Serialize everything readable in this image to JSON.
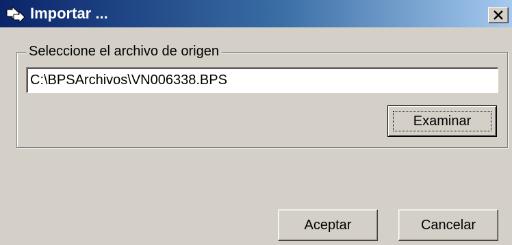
{
  "window": {
    "title": "Importar ...",
    "close_glyph": "X"
  },
  "source_group": {
    "legend": "Seleccione el archivo de origen",
    "path_value": "C:\\BPSArchivos\\VN006338.BPS",
    "browse_label": "Examinar"
  },
  "actions": {
    "accept_label": "Aceptar",
    "cancel_label": "Cancelar"
  },
  "icons": {
    "app": "import-arrow-icon",
    "close": "close-icon"
  },
  "colors": {
    "titlebar_start": "#0a246a",
    "titlebar_end": "#a6caf0",
    "face": "#d4d0c8"
  }
}
